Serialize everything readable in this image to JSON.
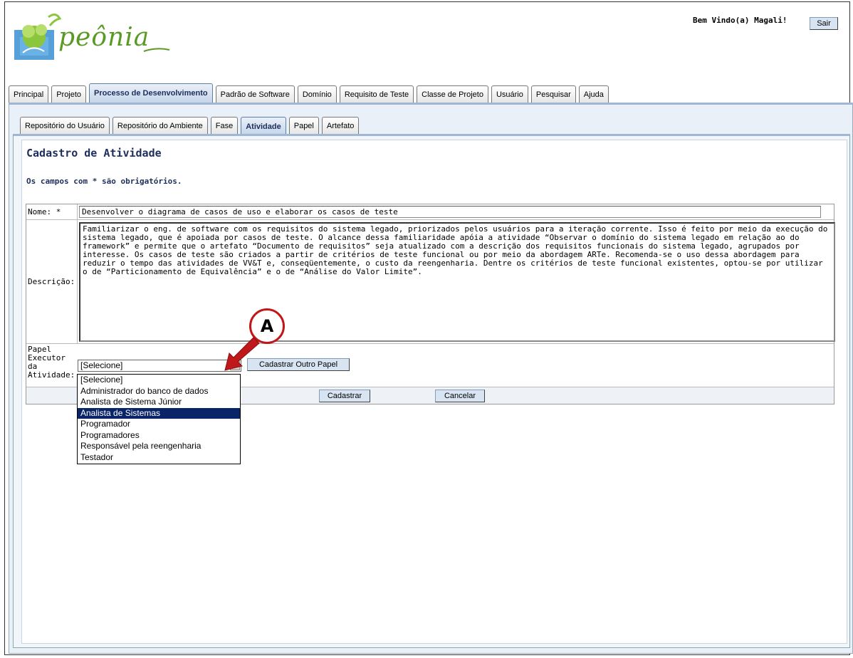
{
  "logo": {
    "text": "peônia"
  },
  "header": {
    "welcome": "Bem Vindo(a) Magali!",
    "logout_label": "Sair"
  },
  "main_tabs": [
    {
      "label": "Principal"
    },
    {
      "label": "Projeto"
    },
    {
      "label": "Processo de Desenvolvimento",
      "active": true
    },
    {
      "label": "Padrão de Software"
    },
    {
      "label": "Domínio"
    },
    {
      "label": "Requisito de Teste"
    },
    {
      "label": "Classe de Projeto"
    },
    {
      "label": "Usuário"
    },
    {
      "label": "Pesquisar"
    },
    {
      "label": "Ajuda"
    }
  ],
  "sub_tabs": [
    {
      "label": "Repositório do Usuário"
    },
    {
      "label": "Repositório do Ambiente"
    },
    {
      "label": "Fase"
    },
    {
      "label": "Atividade",
      "active": true
    },
    {
      "label": "Papel"
    },
    {
      "label": "Artefato"
    }
  ],
  "form": {
    "title": "Cadastro de Atividade",
    "required_note": "Os campos com * são obrigatórios.",
    "nome_label": "Nome: *",
    "nome_value": "Desenvolver o diagrama de casos de uso e elaborar os casos de teste",
    "descricao_label": "Descrição:",
    "descricao_value": "Familiarizar o eng. de software com os requisitos do sistema legado, priorizados pelos usuários para a iteração corrente. Isso é feito por meio da execução do sistema legado, que é apoiada por casos de teste. O alcance dessa familiaridade apóia a atividade “Observar o domínio do sistema legado em relação ao do framework” e permite que o artefato “Documento de requisitos” seja atualizado com a descrição dos requisitos funcionais do sistema legado, agrupados por interesse. Os casos de teste são criados a partir de critérios de teste funcional ou por meio da abordagem ARTe. Recomenda-se o uso dessa abordagem para reduzir o tempo das atividades de VV&T e, conseqüentemente, o custo da reengenharia. Dentre os critérios de teste funcional existentes, optou-se por utilizar o de “Particionamento de Equivalência” e o de “Análise do Valor Limite”.",
    "papel_label_lines": [
      "Papel",
      "Executor",
      "da",
      "Atividade:"
    ],
    "papel_selected": "[Selecione]",
    "papel_options": [
      "[Selecione]",
      "Administrador do banco de dados",
      "Analista de Sistema Júnior",
      "Analista de Sistemas",
      "Programador",
      "Programadores",
      "Responsável pela reengenharia",
      "Testador"
    ],
    "papel_highlighted_index": 3,
    "cadastrar_outro_label": "Cadastrar Outro Papel",
    "submit_label": "Cadastrar",
    "cancel_label": "Cancelar"
  },
  "annotation": {
    "label": "A",
    "color": "#c0171a"
  }
}
